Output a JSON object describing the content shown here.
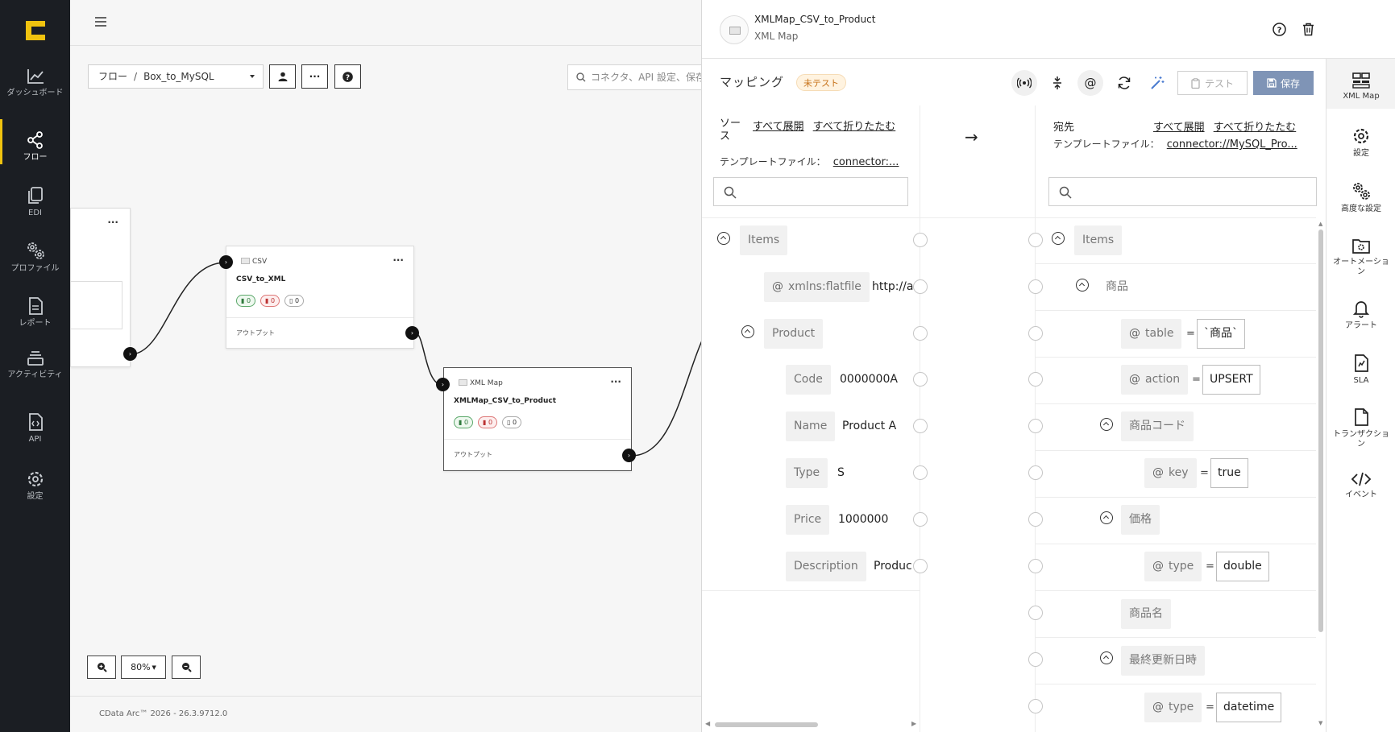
{
  "nav": {
    "items": [
      {
        "label": "ダッシュボード",
        "icon": "chart-line-icon"
      },
      {
        "label": "フロー",
        "icon": "share-nodes-icon"
      },
      {
        "label": "EDI",
        "icon": "documents-icon"
      },
      {
        "label": "プロファイル",
        "icon": "gears-icon"
      },
      {
        "label": "レポート",
        "icon": "report-icon"
      },
      {
        "label": "アクティビティ",
        "icon": "stack-icon"
      },
      {
        "label": "API",
        "icon": "api-file-icon"
      },
      {
        "label": "設定",
        "icon": "gear-icon"
      }
    ],
    "active_index": 1,
    "accent": "#f0c30f"
  },
  "canvas": {
    "breadcrumb_root": "フロー",
    "breadcrumb_sep": "/",
    "breadcrumb_flow": "Box_to_MySQL",
    "search_placeholder": "コネクタ、API 設定、保存",
    "nodes": [
      {
        "type": "CSV",
        "name": "CSV_to_XML",
        "badges": [
          "0",
          "0",
          "0"
        ],
        "output": "アウトプット"
      },
      {
        "type": "XML Map",
        "name": "XMLMap_CSV_to_Product",
        "badges": [
          "0",
          "0",
          "0"
        ],
        "output": "アウトプット"
      }
    ],
    "zoom": "80%",
    "version": "CData Arc™ 2026 - 26.3.9712.0"
  },
  "panel": {
    "title": "XMLMap_CSV_to_Product",
    "subtitle": "XML Map",
    "mapping_label": "マッピング",
    "status_badge": "未テスト",
    "test_label": "テスト",
    "save_label": "保存",
    "save_color": "#7f94b6",
    "arrow": "→",
    "source": {
      "heading": "ソース",
      "expand_all": "すべて展開",
      "collapse_all": "すべて折りたたむ",
      "template_label": "テンプレートファイル：",
      "template_value": "connector:..."
    },
    "dest": {
      "heading": "宛先",
      "expand_all": "すべて展開",
      "collapse_all": "すべて折りたたむ",
      "template_label": "テンプレートファイル：",
      "template_value": "connector://MySQL_Pro..."
    },
    "source_tree": [
      {
        "label": "Items"
      },
      {
        "label": "xmlns:flatfile",
        "value": "http://ar"
      },
      {
        "label": "Product"
      },
      {
        "label": "Code",
        "value": "0000000A"
      },
      {
        "label": "Name",
        "value": "Product A"
      },
      {
        "label": "Type",
        "value": "S"
      },
      {
        "label": "Price",
        "value": "1000000"
      },
      {
        "label": "Description",
        "value": "Produc"
      }
    ],
    "dest_tree": [
      {
        "label": "Items"
      },
      {
        "label": "商品"
      },
      {
        "label": "table",
        "value": "`商品`"
      },
      {
        "label": "action",
        "value": "UPSERT"
      },
      {
        "label": "商品コード"
      },
      {
        "label": "key",
        "value": "true"
      },
      {
        "label": "価格"
      },
      {
        "label": "type",
        "value": "double"
      },
      {
        "label": "商品名"
      },
      {
        "label": "最終更新日時"
      },
      {
        "label": "type",
        "value": "datetime"
      }
    ]
  },
  "rail": {
    "items": [
      {
        "label": "XML Map",
        "icon": "grid-icon"
      },
      {
        "label": "設定",
        "icon": "gear-icon"
      },
      {
        "label": "高度な設定",
        "icon": "gears-icon"
      },
      {
        "label": "オートメーション",
        "icon": "folder-gear-icon"
      },
      {
        "label": "アラート",
        "icon": "bell-icon"
      },
      {
        "label": "SLA",
        "icon": "sla-icon"
      },
      {
        "label": "トランザクション",
        "icon": "file-icon"
      },
      {
        "label": "イベント",
        "icon": "code-icon"
      }
    ]
  }
}
